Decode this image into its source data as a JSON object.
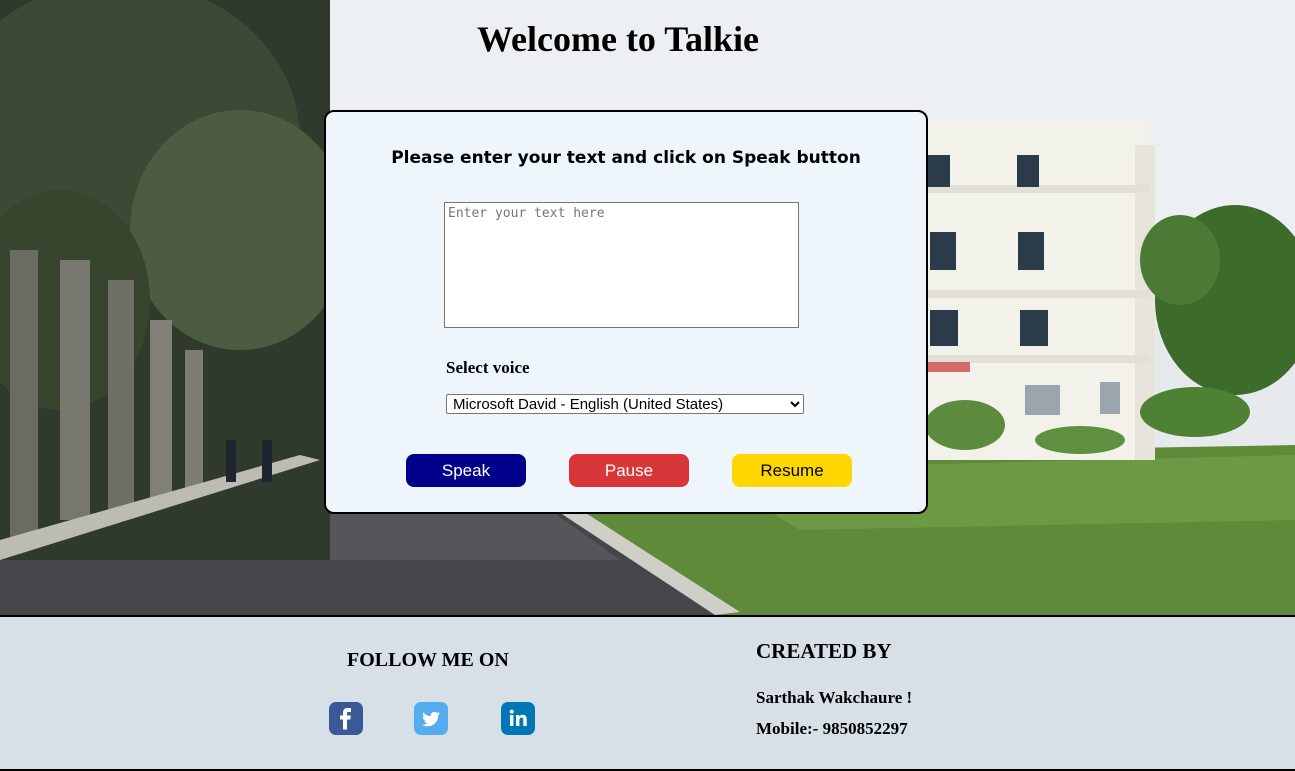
{
  "header": {
    "title": "Welcome to Talkie"
  },
  "form": {
    "instructions": "Please enter your text and click on Speak button",
    "text_placeholder": "Enter your text here",
    "text_value": "",
    "voice_label": "Select voice",
    "voice_selected": "Microsoft David - English (United States)"
  },
  "buttons": {
    "speak": "Speak",
    "pause": "Pause",
    "resume": "Resume"
  },
  "footer": {
    "follow_title": "FOLLOW ME ON",
    "social": [
      {
        "name": "facebook-icon",
        "glyph": "f",
        "color": "#3b5998"
      },
      {
        "name": "twitter-icon",
        "glyph": "t",
        "color": "#55acee"
      },
      {
        "name": "linkedin-icon",
        "glyph": "in",
        "color": "#0077b5"
      }
    ],
    "created_title": "CREATED BY",
    "creator_name": "Sarthak Wakchaure !",
    "creator_mobile": "Mobile:- 9850852297"
  },
  "colors": {
    "speak": "#00008b",
    "pause": "#d9363a",
    "resume": "#ffd700",
    "card_bg": "#eef6fc",
    "footer_bg": "#d6e0e6"
  }
}
